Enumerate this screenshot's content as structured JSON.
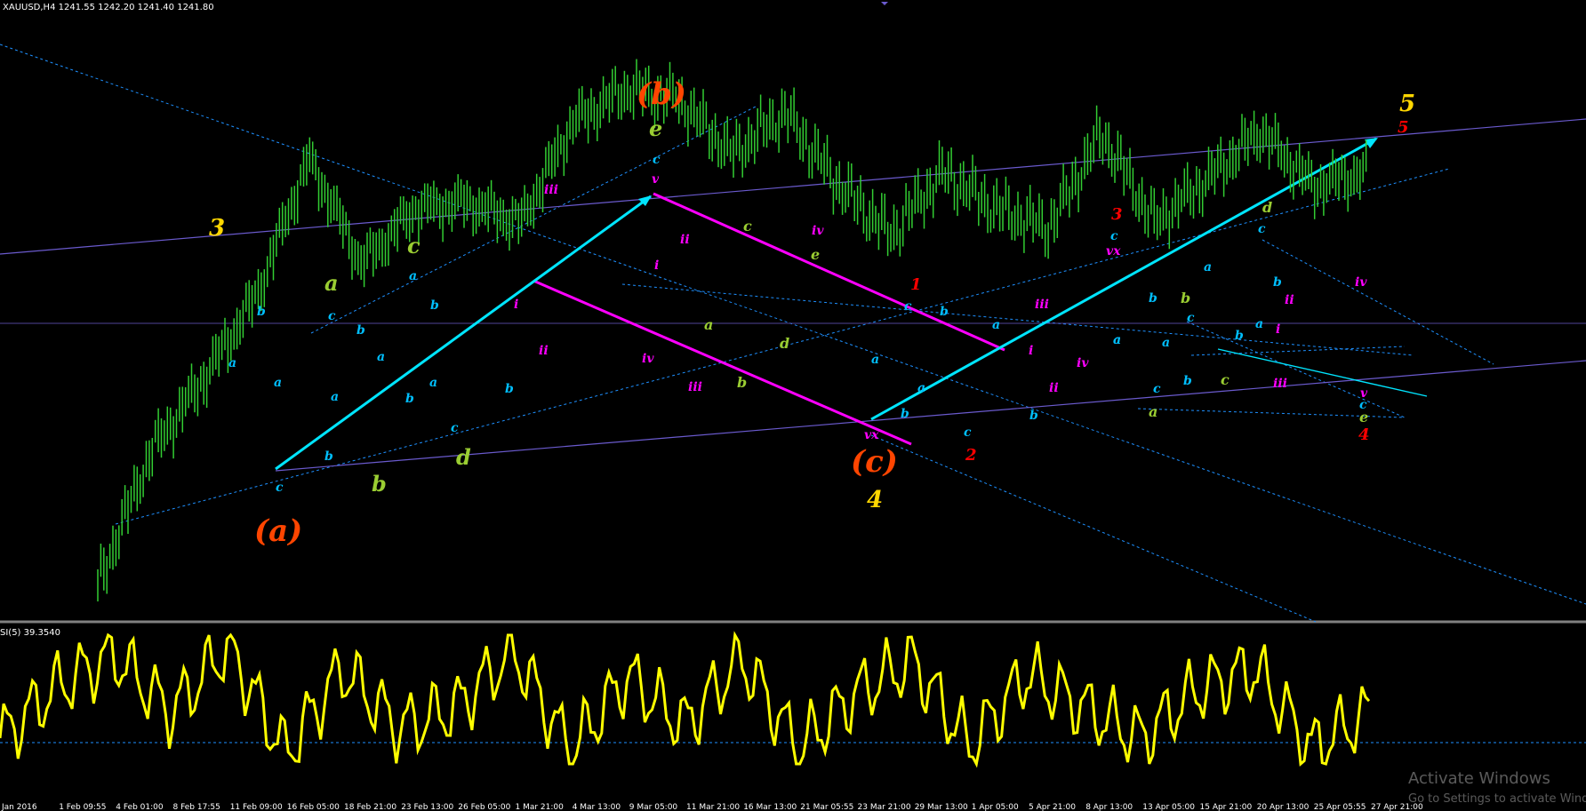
{
  "header": {
    "chart_info": "XAUUSD,H4  1241.55 1242.20 1241.40 1241.80"
  },
  "indicator": {
    "label": "SI(5) 39.3540"
  },
  "watermark": {
    "title": "Activate Windows",
    "subtitle": "Go to Settings to activate Windows."
  },
  "colors": {
    "background": "#000000",
    "candles": "#32cd32",
    "indicator_line": "#ffff00",
    "cyan_arrow": "#00e5ff",
    "magenta_channel": "#ff00ff",
    "blue_trend": "#6a5acd",
    "dotted_lines": "#1e90ff",
    "orange_labels": "#ff4500",
    "yellow_labels": "#ffd700",
    "green_labels": "#9acd32",
    "cyan_labels": "#00bfff",
    "magenta_labels": "#ff00ff",
    "red_labels": "#ff0000"
  },
  "chart_data": {
    "type": "line",
    "title": "XAUUSD,H4",
    "xlabel": "",
    "ylabel": "",
    "x": [
      "Jan 2016",
      "1 Feb 09:55",
      "4 Feb 01:00",
      "8 Feb 17:55",
      "11 Feb 09:00",
      "16 Feb 05:00",
      "18 Feb 21:00",
      "23 Feb 13:00",
      "26 Feb 05:00",
      "1 Mar 21:00",
      "4 Mar 13:00",
      "9 Mar 05:00",
      "11 Mar 21:00",
      "16 Mar 13:00",
      "21 Mar 05:55",
      "23 Mar 21:00",
      "29 Mar 13:00",
      "1 Apr 05:00",
      "5 Apr 21:00",
      "8 Apr 13:00",
      "13 Apr 05:00",
      "15 Apr 21:00",
      "20 Apr 13:00",
      "25 Apr 05:55",
      "27 Apr 21:00"
    ],
    "series": [
      {
        "name": "XAUUSD",
        "values": [
          1062,
          1120,
          1152,
          1188,
          1248,
          1202,
          1226,
          1229,
          1220,
          1264,
          1278,
          1274,
          1250,
          1268,
          1237,
          1215,
          1242,
          1226,
          1218,
          1259,
          1220,
          1239,
          1260,
          1236,
          1242
        ]
      },
      {
        "name": "SI(5)",
        "values": [
          20,
          60,
          85,
          40,
          92,
          8,
          74,
          28,
          44,
          88,
          10,
          68,
          30,
          82,
          12,
          55,
          80,
          14,
          70,
          44,
          20,
          58,
          74,
          12,
          39.354
        ]
      }
    ],
    "grid": false,
    "legend": "none",
    "annotations": {
      "wave_labels": [
        "(a)",
        "(b)",
        "(c)",
        "3",
        "4",
        "5",
        "1",
        "2",
        "3",
        "4",
        "5",
        "a",
        "b",
        "c",
        "d",
        "e",
        "i",
        "ii",
        "iii",
        "iv",
        "v",
        "vx"
      ]
    }
  },
  "labels": [
    {
      "id": "lbl-a-orange",
      "text": "(a)",
      "color": "#ff4500",
      "size": "large"
    },
    {
      "id": "lbl-b-orange",
      "text": "(b)",
      "color": "#ff4500",
      "size": "large"
    },
    {
      "id": "lbl-c-orange",
      "text": "(c)",
      "color": "#ff4500",
      "size": "large"
    },
    {
      "id": "lbl-3-yellow",
      "text": "3",
      "color": "#ffd700",
      "size": "medium"
    },
    {
      "id": "lbl-4-yellow",
      "text": "4",
      "color": "#ffd700",
      "size": "medium"
    },
    {
      "id": "lbl-5-yellow",
      "text": "5",
      "color": "#ffd700",
      "size": "medium"
    },
    {
      "id": "lbl-5-red",
      "text": "5",
      "color": "#ff0000",
      "size": "small"
    },
    {
      "id": "lbl-1-red",
      "text": "1",
      "color": "#ff0000",
      "size": "small"
    },
    {
      "id": "lbl-2-red",
      "text": "2",
      "color": "#ff0000",
      "size": "small"
    },
    {
      "id": "lbl-3-red",
      "text": "3",
      "color": "#ff0000",
      "size": "small"
    },
    {
      "id": "lbl-4-red",
      "text": "4",
      "color": "#ff0000",
      "size": "small"
    },
    {
      "id": "lbl-e-green-top",
      "text": "e",
      "color": "#9acd32",
      "size": "medium"
    },
    {
      "id": "lbl-c-green",
      "text": "c",
      "color": "#9acd32",
      "size": "medium"
    },
    {
      "id": "lbl-a-green",
      "text": "a",
      "color": "#9acd32",
      "size": "medium"
    },
    {
      "id": "lbl-b-green",
      "text": "b",
      "color": "#9acd32",
      "size": "medium"
    },
    {
      "id": "lbl-d-green",
      "text": "d",
      "color": "#9acd32",
      "size": "medium"
    },
    {
      "id": "lbl-c-green-small",
      "text": "c",
      "color": "#9acd32",
      "size": "small"
    },
    {
      "id": "lbl-e-green-small",
      "text": "e",
      "color": "#9acd32",
      "size": "small"
    },
    {
      "id": "lbl-a-green-small",
      "text": "a",
      "color": "#9acd32",
      "size": "small"
    },
    {
      "id": "lbl-d-green-small",
      "text": "d",
      "color": "#9acd32",
      "size": "small"
    },
    {
      "id": "lbl-b-green-small",
      "text": "b",
      "color": "#9acd32",
      "size": "small"
    },
    {
      "id": "lbl-d-green-right",
      "text": "d",
      "color": "#9acd32",
      "size": "small"
    },
    {
      "id": "lbl-a-green-right",
      "text": "a",
      "color": "#9acd32",
      "size": "small"
    },
    {
      "id": "lbl-b-green-right",
      "text": "b",
      "color": "#9acd32",
      "size": "small"
    },
    {
      "id": "lbl-c-green-right",
      "text": "c",
      "color": "#9acd32",
      "size": "small"
    },
    {
      "id": "lbl-e-green-right",
      "text": "e",
      "color": "#9acd32",
      "size": "small"
    }
  ],
  "small_labels": [
    {
      "id": "b1",
      "text": "b",
      "color": "#00bfff"
    },
    {
      "id": "a1",
      "text": "a",
      "color": "#00bfff"
    },
    {
      "id": "a2",
      "text": "a",
      "color": "#00bfff"
    },
    {
      "id": "c1",
      "text": "c",
      "color": "#00bfff"
    },
    {
      "id": "c2",
      "text": "c",
      "color": "#00bfff"
    },
    {
      "id": "b2",
      "text": "b",
      "color": "#00bfff"
    },
    {
      "id": "b3",
      "text": "b",
      "color": "#00bfff"
    },
    {
      "id": "a3",
      "text": "a",
      "color": "#00bfff"
    },
    {
      "id": "a4",
      "text": "a",
      "color": "#00bfff"
    },
    {
      "id": "b4",
      "text": "b",
      "color": "#00bfff"
    },
    {
      "id": "a5",
      "text": "a",
      "color": "#00bfff"
    },
    {
      "id": "b5",
      "text": "b",
      "color": "#00bfff"
    },
    {
      "id": "a6",
      "text": "a",
      "color": "#00bfff"
    },
    {
      "id": "c3",
      "text": "c",
      "color": "#00bfff"
    },
    {
      "id": "b6",
      "text": "b",
      "color": "#00bfff"
    },
    {
      "id": "c4",
      "text": "c",
      "color": "#00bfff"
    },
    {
      "id": "v1",
      "text": "v",
      "color": "#ff00ff"
    },
    {
      "id": "iii1",
      "text": "iii",
      "color": "#ff00ff"
    },
    {
      "id": "ii1",
      "text": "ii",
      "color": "#ff00ff"
    },
    {
      "id": "i1",
      "text": "i",
      "color": "#ff00ff"
    },
    {
      "id": "ii2",
      "text": "ii",
      "color": "#ff00ff"
    },
    {
      "id": "i2",
      "text": "i",
      "color": "#ff00ff"
    },
    {
      "id": "iv1",
      "text": "iv",
      "color": "#ff00ff"
    },
    {
      "id": "iii2",
      "text": "iii",
      "color": "#ff00ff"
    },
    {
      "id": "iv2",
      "text": "iv",
      "color": "#ff00ff"
    },
    {
      "id": "vx1",
      "text": "vx",
      "color": "#ff00ff"
    },
    {
      "id": "c5",
      "text": "c",
      "color": "#00bfff"
    },
    {
      "id": "b7",
      "text": "b",
      "color": "#00bfff"
    },
    {
      "id": "a7",
      "text": "a",
      "color": "#00bfff"
    },
    {
      "id": "a8",
      "text": "a",
      "color": "#00bfff"
    },
    {
      "id": "b8",
      "text": "b",
      "color": "#00bfff"
    },
    {
      "id": "a9",
      "text": "a",
      "color": "#00bfff"
    },
    {
      "id": "c6",
      "text": "c",
      "color": "#00bfff"
    },
    {
      "id": "b9",
      "text": "b",
      "color": "#00bfff"
    },
    {
      "id": "a10",
      "text": "a",
      "color": "#00bfff"
    },
    {
      "id": "i3",
      "text": "i",
      "color": "#ff00ff"
    },
    {
      "id": "iii3",
      "text": "iii",
      "color": "#ff00ff"
    },
    {
      "id": "ii3",
      "text": "ii",
      "color": "#ff00ff"
    },
    {
      "id": "iv3",
      "text": "iv",
      "color": "#ff00ff"
    },
    {
      "id": "vx2",
      "text": "vx",
      "color": "#ff00ff"
    },
    {
      "id": "c7",
      "text": "c",
      "color": "#00bfff"
    },
    {
      "id": "a11",
      "text": "a",
      "color": "#00bfff"
    },
    {
      "id": "b10",
      "text": "b",
      "color": "#00bfff"
    },
    {
      "id": "a12",
      "text": "a",
      "color": "#00bfff"
    },
    {
      "id": "c8",
      "text": "c",
      "color": "#00bfff"
    },
    {
      "id": "b11",
      "text": "b",
      "color": "#00bfff"
    },
    {
      "id": "c9",
      "text": "c",
      "color": "#00bfff"
    },
    {
      "id": "a13",
      "text": "a",
      "color": "#00bfff"
    },
    {
      "id": "b12",
      "text": "b",
      "color": "#00bfff"
    },
    {
      "id": "c10",
      "text": "c",
      "color": "#00bfff"
    },
    {
      "id": "b13",
      "text": "b",
      "color": "#00bfff"
    },
    {
      "id": "a14",
      "text": "a",
      "color": "#00bfff"
    },
    {
      "id": "ii4",
      "text": "ii",
      "color": "#ff00ff"
    },
    {
      "id": "i4",
      "text": "i",
      "color": "#ff00ff"
    },
    {
      "id": "iii4",
      "text": "iii",
      "color": "#ff00ff"
    },
    {
      "id": "iv4",
      "text": "iv",
      "color": "#ff00ff"
    },
    {
      "id": "v2",
      "text": "v",
      "color": "#ff00ff"
    },
    {
      "id": "c11",
      "text": "c",
      "color": "#00bfff"
    }
  ]
}
